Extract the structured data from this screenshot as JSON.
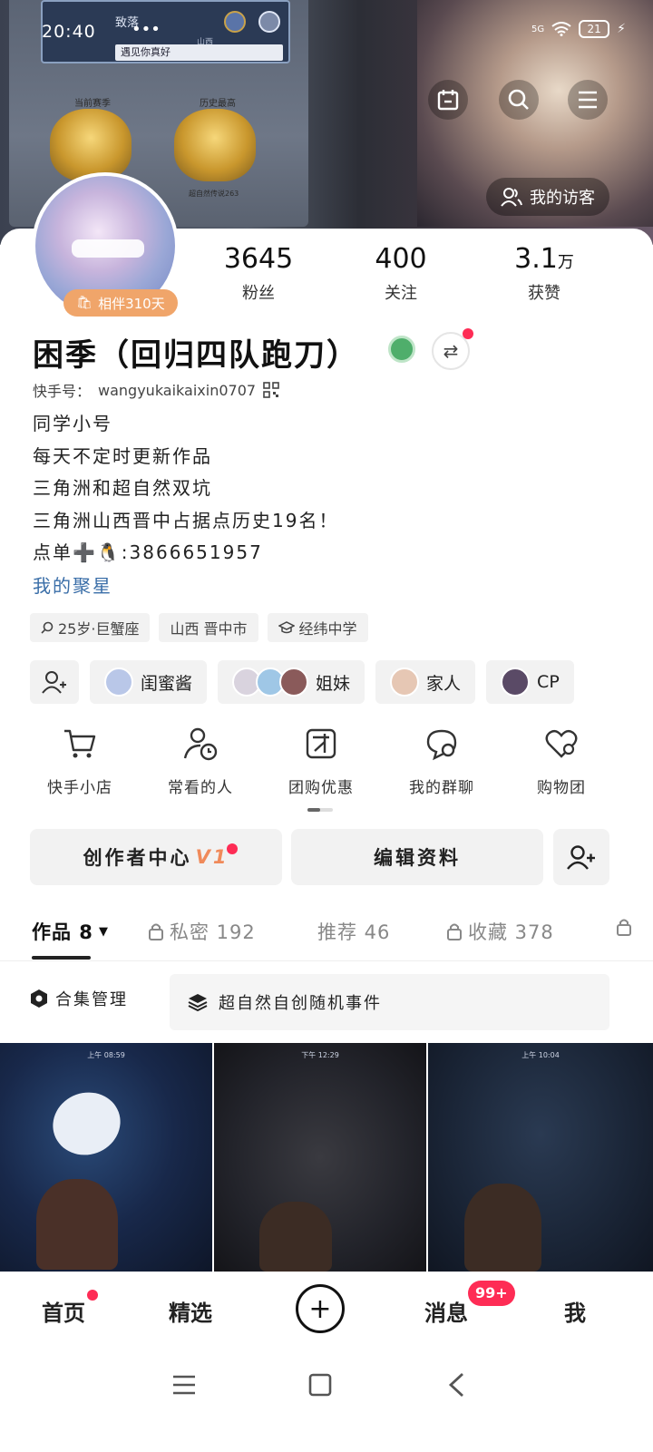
{
  "status_bar": {
    "time": "20:40",
    "dots": "•••",
    "network": "5G",
    "battery": "21"
  },
  "banner": {
    "card_name": "致落",
    "card_region": "山西",
    "card_greeting": "遇见你真好",
    "medal_left_label": "当前赛季",
    "medal_right_label": "历史最高",
    "medal_right_sub": "超自然传说263",
    "visitors_label": "我的访客"
  },
  "profile": {
    "companion_badge": "相伴310天",
    "stats": [
      {
        "num": "3645",
        "label": "粉丝"
      },
      {
        "num": "400",
        "label": "关注"
      },
      {
        "num": "3.1",
        "unit": "万",
        "label": "获赞"
      }
    ],
    "username": "困季（回归四队跑刀）",
    "uid_label": "快手号：",
    "uid": "wangyukaikaixin0707",
    "bio_lines": [
      "同学小号",
      "每天不定时更新作品",
      "三角洲和超自然双坑",
      "三角洲山西晋中占据点历史19名！",
      "点单➕🐧:3866651957"
    ],
    "bio_link": "我的聚星",
    "tags": [
      "25岁·巨蟹座",
      "山西 晋中市",
      "经纬中学"
    ],
    "relations": [
      "闺蜜酱",
      "姐妹",
      "家人",
      "CP"
    ]
  },
  "shortcuts": [
    {
      "label": "快手小店",
      "icon": "cart-icon"
    },
    {
      "label": "常看的人",
      "icon": "person-clock-icon"
    },
    {
      "label": "团购优惠",
      "icon": "group-buy-icon"
    },
    {
      "label": "我的群聊",
      "icon": "chat-icon"
    },
    {
      "label": "购物团",
      "icon": "heart-icon"
    }
  ],
  "actions": {
    "creator_center": "创作者中心",
    "creator_level": "V1",
    "edit_profile": "编辑资料"
  },
  "tabs": [
    {
      "label": "作品 8"
    },
    {
      "label": "私密 192"
    },
    {
      "label": "推荐 46"
    },
    {
      "label": "收藏 378"
    }
  ],
  "collection": {
    "manage": "合集管理",
    "chip": "超自然自创随机事件"
  },
  "thumbs": [
    {
      "time": "上午 08:59"
    },
    {
      "time": "下午 12:29"
    },
    {
      "time": "上午 10:04"
    }
  ],
  "bottom_nav": {
    "home": "首页",
    "featured": "精选",
    "messages": "消息",
    "messages_badge": "99+",
    "me": "我"
  },
  "colors": {
    "accent_red": "#fe2c55",
    "link_blue": "#3a6ea8",
    "badge_orange": "#f0a56a"
  }
}
